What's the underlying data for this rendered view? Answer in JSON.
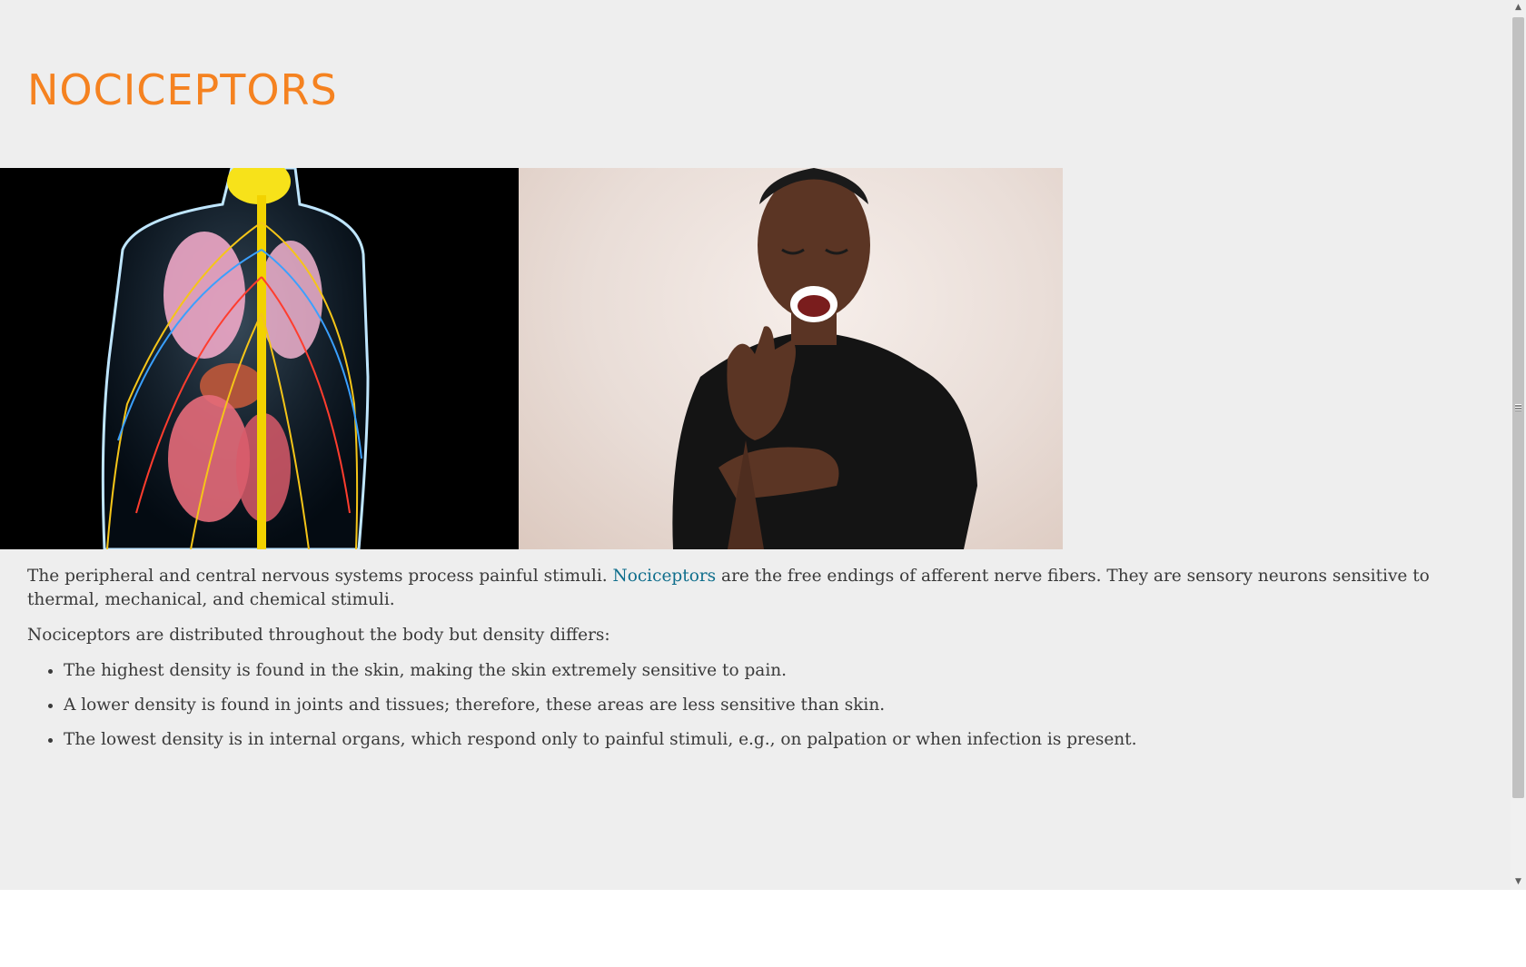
{
  "page": {
    "title": "NOCICEPTORS"
  },
  "hero": {
    "left_image": "anatomy-nervous-system-illustration",
    "right_image": "man-holding-painful-wrist-photo"
  },
  "content": {
    "intro_before_link": "The peripheral and central nervous systems process painful stimuli. ",
    "intro_link": "Nociceptors",
    "intro_after_link": " are the free endings of afferent nerve fibers. They are sensory neurons sensitive to thermal, mechanical, and chemical stimuli.",
    "distribution_intro": "Nociceptors are distributed throughout the body but density differs:",
    "bullets": [
      "The highest density is found in the skin, making the skin extremely sensitive to pain.",
      "A lower density is found in joints and tissues; therefore, these areas are less sensitive than skin.",
      "The lowest density is in internal organs, which respond only to painful stimuli, e.g., on palpation or when infection is present."
    ]
  },
  "colors": {
    "title": "#f58220",
    "link": "#0f6e8c",
    "background": "#eeeeee",
    "text": "#3a3a3a"
  },
  "scrollbar": {
    "up_icon": "scroll-up-arrow-icon",
    "down_icon": "scroll-down-arrow-icon"
  }
}
